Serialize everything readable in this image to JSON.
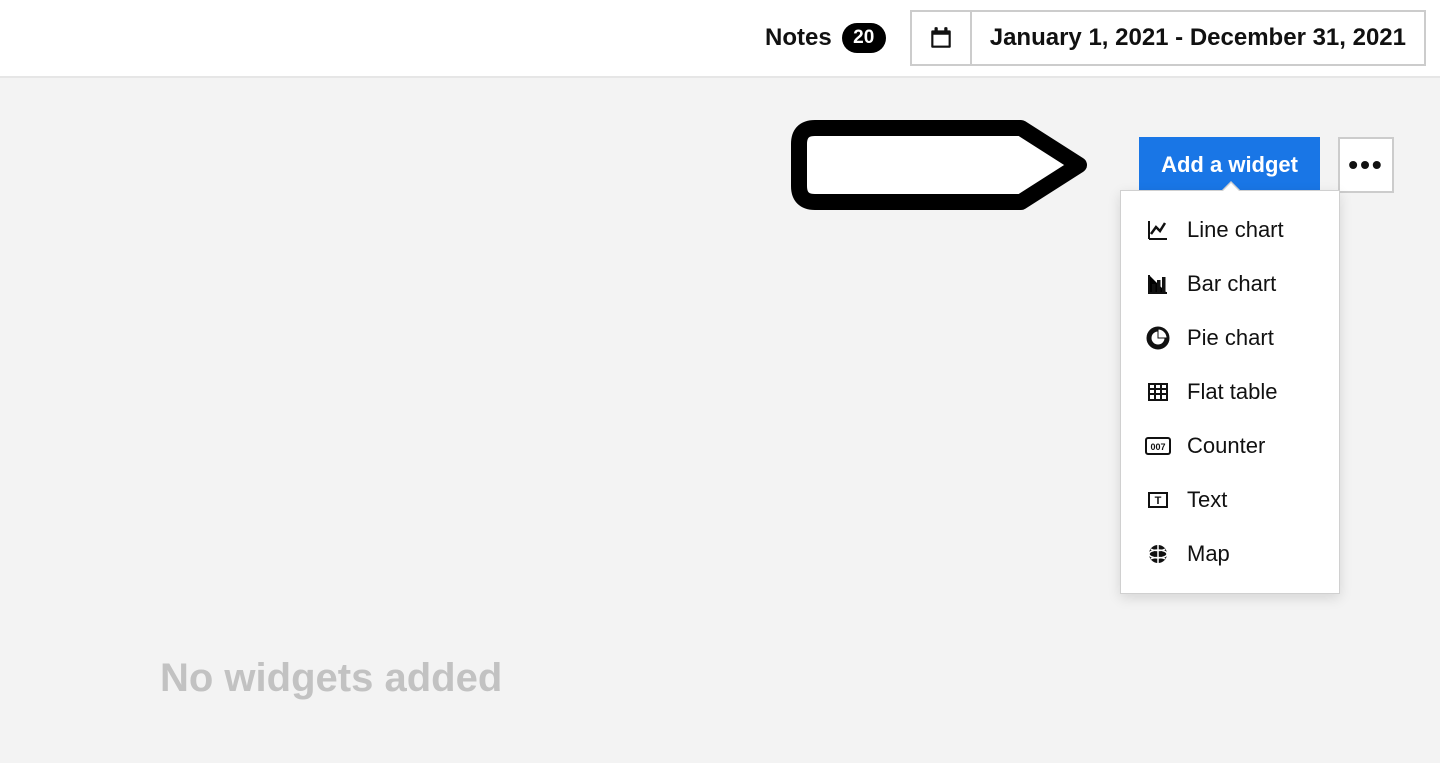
{
  "topbar": {
    "notes_label": "Notes",
    "notes_count": "20",
    "date_range": "January 1, 2021 - December 31, 2021"
  },
  "actions": {
    "add_widget_label": "Add a widget"
  },
  "widget_menu": {
    "items": [
      {
        "label": "Line chart",
        "icon": "line-chart-icon"
      },
      {
        "label": "Bar chart",
        "icon": "bar-chart-icon"
      },
      {
        "label": "Pie chart",
        "icon": "pie-chart-icon"
      },
      {
        "label": "Flat table",
        "icon": "table-icon"
      },
      {
        "label": "Counter",
        "icon": "counter-icon"
      },
      {
        "label": "Text",
        "icon": "text-icon"
      },
      {
        "label": "Map",
        "icon": "globe-icon"
      }
    ]
  },
  "empty_state": {
    "message": "No widgets added"
  }
}
